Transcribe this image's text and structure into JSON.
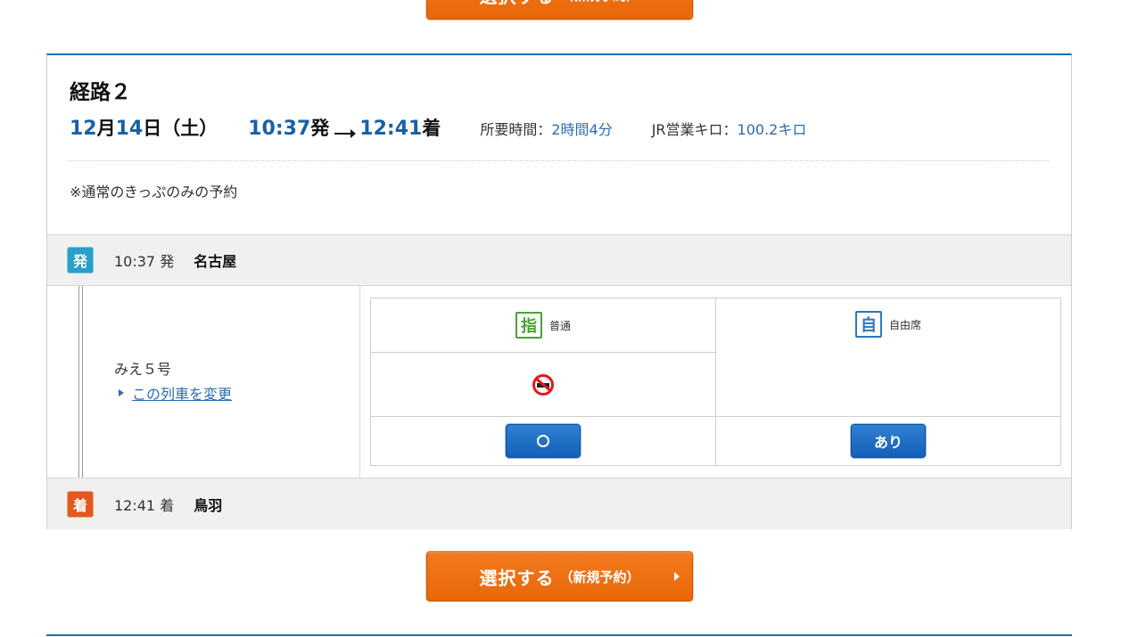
{
  "select_button": {
    "label": "選択する",
    "sub_label": "（新規予約）"
  },
  "route": {
    "title": "経路２",
    "date": {
      "month": "12",
      "month_unit": "月",
      "day": "14",
      "day_unit": "日",
      "weekday": "（土）"
    },
    "depart_time": "10:37",
    "depart_suffix": "発",
    "arrive_time": "12:41",
    "arrive_suffix": "着",
    "duration_label": "所要時間：",
    "duration_value": "2時間4分",
    "distance_label": "JR営業キロ：",
    "distance_value": "100.2キロ",
    "note": "※通常のきっぷのみの予約"
  },
  "departure": {
    "badge": "発",
    "time": "10:37 発",
    "station": "名古屋"
  },
  "train": {
    "name": "みえ５号",
    "change_link": "この列車を変更"
  },
  "seats": {
    "reserved": {
      "icon": "指",
      "label": "普通",
      "availability": "○",
      "icon_color": "#4aa234"
    },
    "non_reserved": {
      "icon": "自",
      "label": "自由席",
      "availability": "あり",
      "icon_color": "#2d77c0"
    },
    "smoking_icon": "no-smoking-icon"
  },
  "arrival": {
    "badge": "着",
    "time": "12:41 着",
    "station": "鳥羽"
  },
  "colors": {
    "accent_orange": "#e86707",
    "accent_blue": "#1b6fb5",
    "button_blue": "#1560b6"
  }
}
